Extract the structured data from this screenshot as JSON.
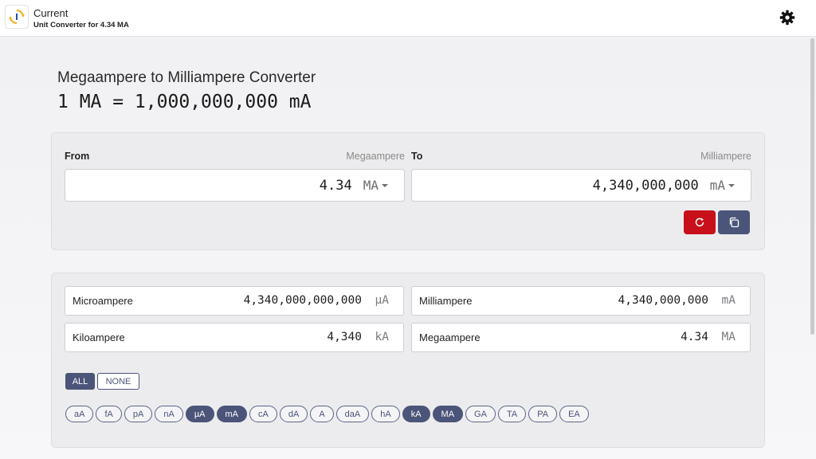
{
  "app": {
    "title": "Current",
    "subtitle": "Unit Converter for 4.34 MA"
  },
  "heading": "Megaampere to Milliampere Converter",
  "equation": "1 MA = 1,000,000,000 mA",
  "from": {
    "label": "From",
    "unit_name": "Megaampere",
    "value": "4.34",
    "unit": "MA"
  },
  "to": {
    "label": "To",
    "unit_name": "Milliampere",
    "value": "4,340,000,000",
    "unit": "mA"
  },
  "colors": {
    "accent": "#4b5579",
    "swap": "#c8101a"
  },
  "results": [
    {
      "name": "Microampere",
      "value": "4,340,000,000,000",
      "unit": "µA"
    },
    {
      "name": "Milliampere",
      "value": "4,340,000,000",
      "unit": "mA"
    },
    {
      "name": "Kiloampere",
      "value": "4,340",
      "unit": "kA"
    },
    {
      "name": "Megaampere",
      "value": "4.34",
      "unit": "MA"
    }
  ],
  "select": {
    "all": "ALL",
    "none": "NONE"
  },
  "chips": [
    {
      "label": "aA",
      "selected": false
    },
    {
      "label": "fA",
      "selected": false
    },
    {
      "label": "pA",
      "selected": false
    },
    {
      "label": "nA",
      "selected": false
    },
    {
      "label": "µA",
      "selected": true
    },
    {
      "label": "mA",
      "selected": true
    },
    {
      "label": "cA",
      "selected": false
    },
    {
      "label": "dA",
      "selected": false
    },
    {
      "label": "A",
      "selected": false
    },
    {
      "label": "daA",
      "selected": false
    },
    {
      "label": "hA",
      "selected": false
    },
    {
      "label": "kA",
      "selected": true
    },
    {
      "label": "MA",
      "selected": true
    },
    {
      "label": "GA",
      "selected": false
    },
    {
      "label": "TA",
      "selected": false
    },
    {
      "label": "PA",
      "selected": false
    },
    {
      "label": "EA",
      "selected": false
    }
  ]
}
